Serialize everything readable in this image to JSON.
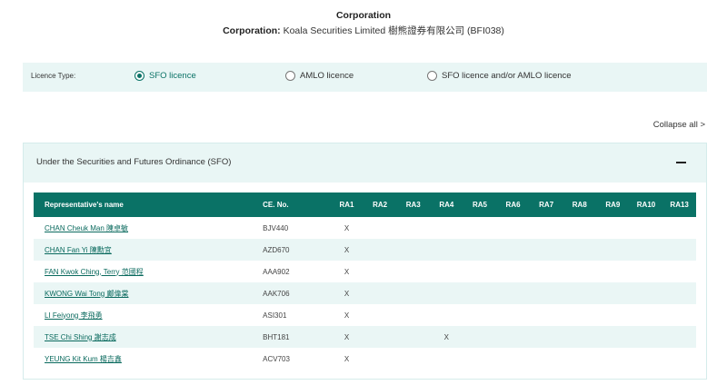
{
  "header": {
    "title": "Corporation",
    "corp_label": "Corporation:",
    "corp_name": "Koala Securities Limited 樹熊證券有限公司 (BFI038)"
  },
  "licence": {
    "label": "Licence Type:",
    "options": [
      {
        "label": "SFO licence",
        "selected": true
      },
      {
        "label": "AMLO licence",
        "selected": false
      },
      {
        "label": "SFO licence and/or AMLO licence",
        "selected": false
      }
    ]
  },
  "collapse_all": "Collapse all >",
  "section": {
    "title": "Under the Securities and Futures Ordinance (SFO)",
    "columns": [
      "Representative's name",
      "CE. No.",
      "RA1",
      "RA2",
      "RA3",
      "RA4",
      "RA5",
      "RA6",
      "RA7",
      "RA8",
      "RA9",
      "RA10",
      "RA13"
    ],
    "rows": [
      {
        "name": "CHAN Cheuk Man 陳卓敏",
        "ce": "BJV440",
        "ra": [
          "X",
          "",
          "",
          "",
          "",
          "",
          "",
          "",
          "",
          "",
          ""
        ]
      },
      {
        "name": "CHAN Fan Yi 陳勳宜",
        "ce": "AZD670",
        "ra": [
          "X",
          "",
          "",
          "",
          "",
          "",
          "",
          "",
          "",
          "",
          ""
        ]
      },
      {
        "name": "FAN Kwok Ching, Terry 范國程",
        "ce": "AAA902",
        "ra": [
          "X",
          "",
          "",
          "",
          "",
          "",
          "",
          "",
          "",
          "",
          ""
        ]
      },
      {
        "name": "KWONG Wai Tong 鄺偉棠",
        "ce": "AAK706",
        "ra": [
          "X",
          "",
          "",
          "",
          "",
          "",
          "",
          "",
          "",
          "",
          ""
        ]
      },
      {
        "name": "LI Feiyong 李飛勇",
        "ce": "ASI301",
        "ra": [
          "X",
          "",
          "",
          "",
          "",
          "",
          "",
          "",
          "",
          "",
          ""
        ]
      },
      {
        "name": "TSE Chi Shing 謝志成",
        "ce": "BHT181",
        "ra": [
          "X",
          "",
          "",
          "X",
          "",
          "",
          "",
          "",
          "",
          "",
          ""
        ]
      },
      {
        "name": "YEUNG Kit Kum 楊吉鑫",
        "ce": "ACV703",
        "ra": [
          "X",
          "",
          "",
          "",
          "",
          "",
          "",
          "",
          "",
          "",
          ""
        ]
      }
    ]
  }
}
